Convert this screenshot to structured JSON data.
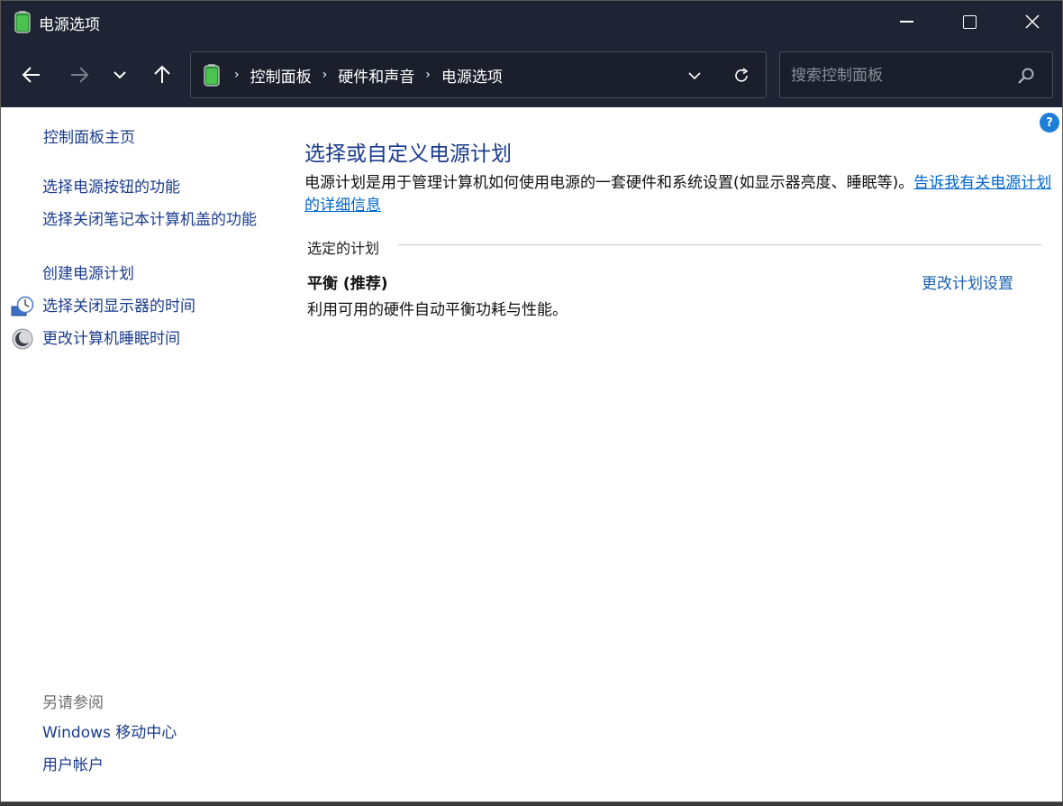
{
  "window": {
    "title": "电源选项"
  },
  "navigation": {
    "breadcrumbs": [
      {
        "label": "控制面板"
      },
      {
        "label": "硬件和声音"
      },
      {
        "label": "电源选项"
      }
    ],
    "breadcrumb_separator": "›",
    "search_placeholder": "搜索控制面板"
  },
  "sidebar": {
    "home": "控制面板主页",
    "links": [
      "选择电源按钮的功能",
      "选择关闭笔记本计算机盖的功能",
      "创建电源计划",
      "选择关闭显示器的时间",
      "更改计算机睡眠时间"
    ],
    "see_also_heading": "另请参阅",
    "see_also": [
      "Windows 移动中心",
      "用户帐户"
    ]
  },
  "main": {
    "help": "?",
    "title": "选择或自定义电源计划",
    "description": "电源计划是用于管理计算机如何使用电源的一套硬件和系统设置(如显示器亮度、睡眠等)。",
    "description_link": "告诉我有关电源计划的详细信息",
    "selected_plan_label": "选定的计划",
    "plan": {
      "name": "平衡 (推荐)",
      "description": "利用可用的硬件自动平衡功耗与性能。",
      "change_link": "更改计划设置"
    }
  },
  "colors": {
    "titlebar": "#1f2434",
    "link": "#1a3b8c",
    "accent": "#1e7fd8"
  }
}
